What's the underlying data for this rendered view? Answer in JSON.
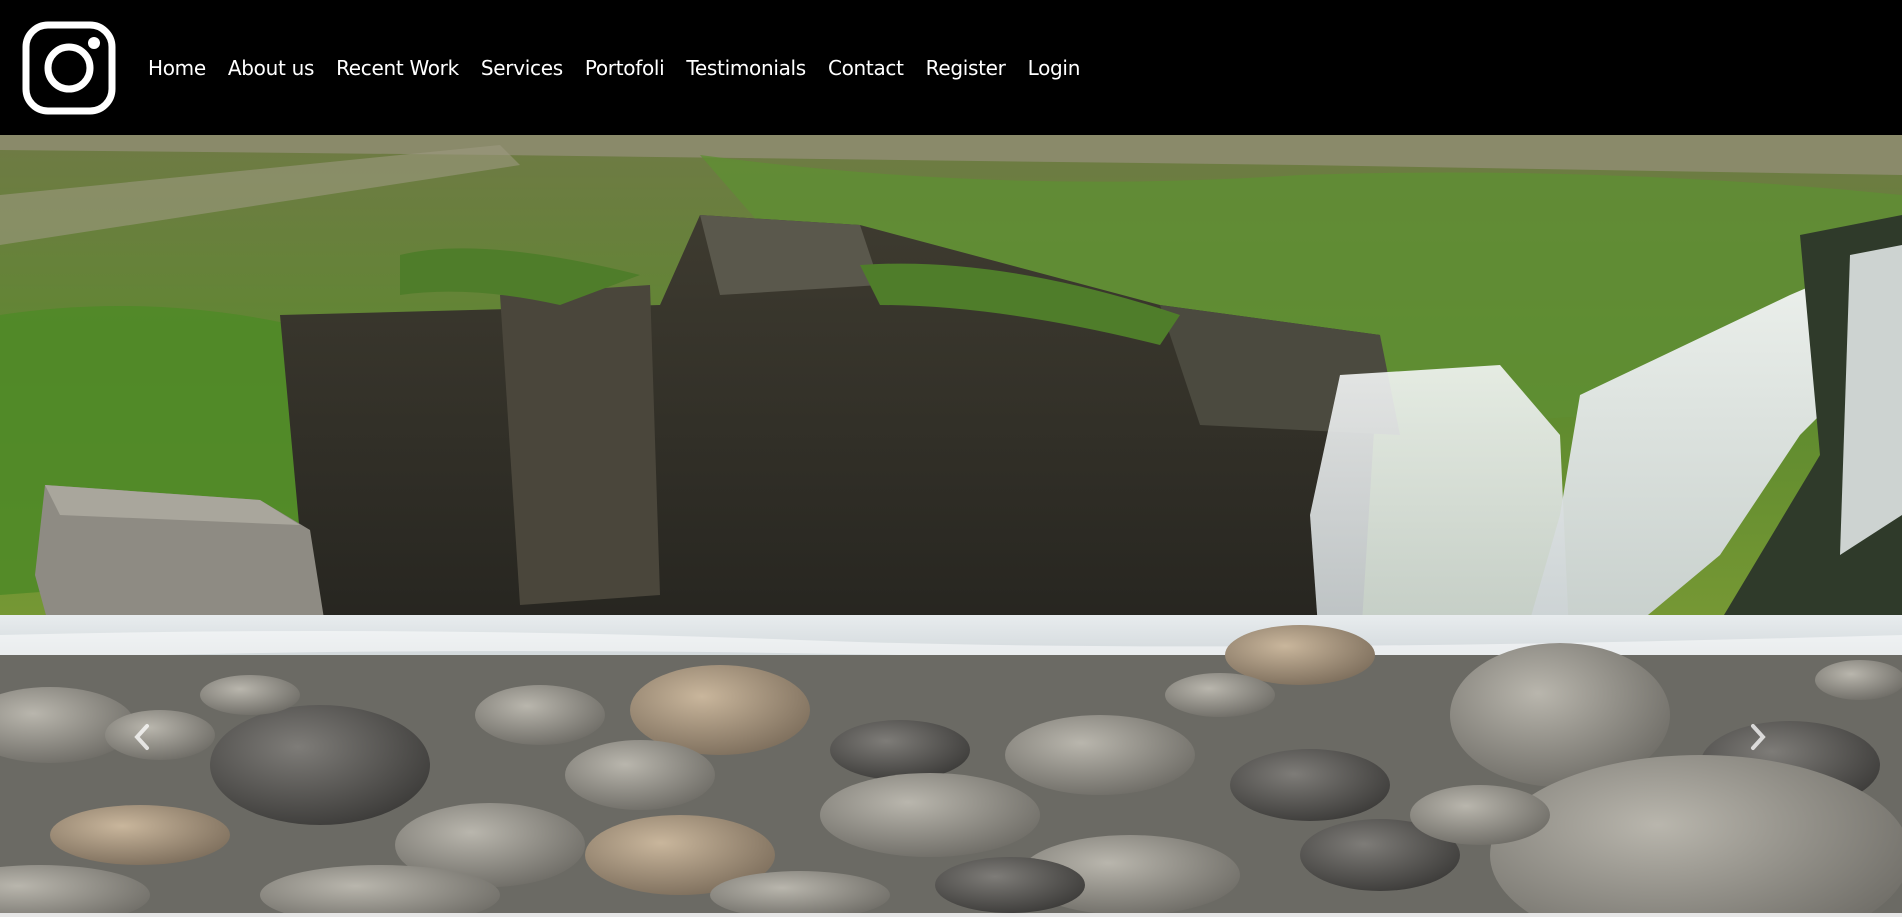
{
  "logo": {
    "icon": "instagram-icon"
  },
  "nav": {
    "items": [
      {
        "label": "Home"
      },
      {
        "label": "About us"
      },
      {
        "label": "Recent Work"
      },
      {
        "label": "Services"
      },
      {
        "label": "Portofoli"
      },
      {
        "label": "Testimonials"
      },
      {
        "label": "Contact"
      },
      {
        "label": "Register"
      },
      {
        "label": "Login"
      }
    ]
  },
  "hero": {
    "subject": "waterfall landscape video background",
    "controls": {
      "prev_icon": "chevron-left-icon",
      "next_icon": "chevron-right-icon"
    }
  },
  "colors": {
    "navbar_bg": "#000000",
    "nav_text": "#ffffff"
  }
}
